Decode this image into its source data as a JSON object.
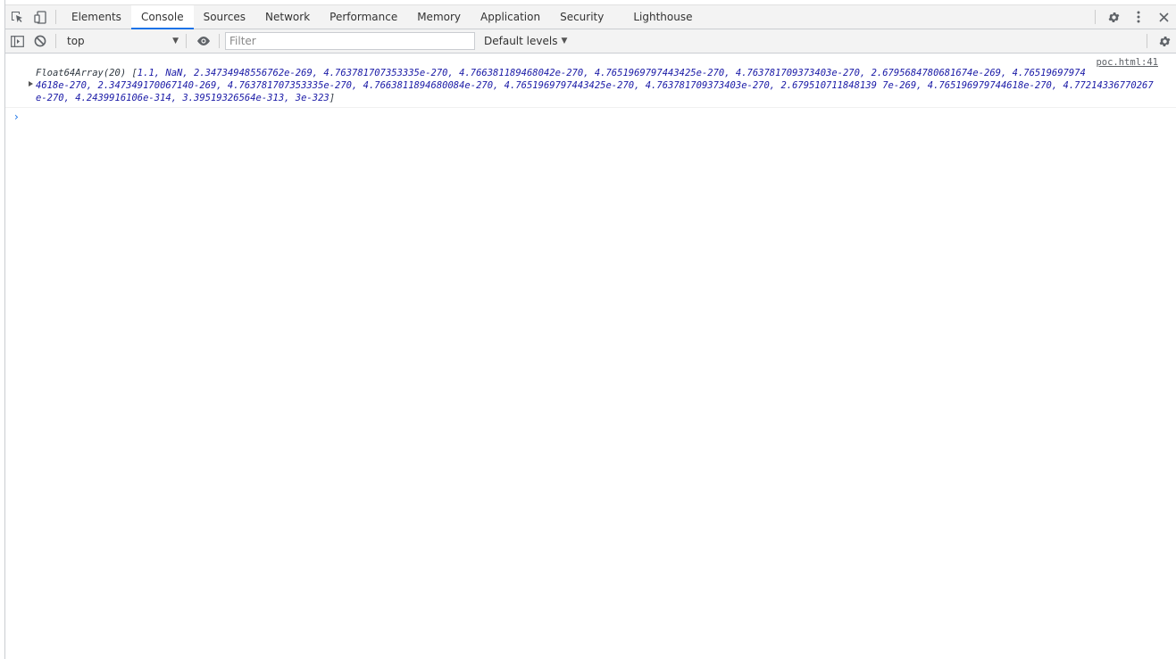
{
  "tabs": [
    {
      "label": "Elements",
      "active": false
    },
    {
      "label": "Console",
      "active": true
    },
    {
      "label": "Sources",
      "active": false
    },
    {
      "label": "Network",
      "active": false
    },
    {
      "label": "Performance",
      "active": false
    },
    {
      "label": "Memory",
      "active": false
    },
    {
      "label": "Application",
      "active": false
    },
    {
      "label": "Security",
      "active": false
    },
    {
      "label": "Lighthouse",
      "active": false
    }
  ],
  "toolbar": {
    "context": "top",
    "filter_placeholder": "Filter",
    "levels_label": "Default levels"
  },
  "console": {
    "message": {
      "source": "poc.html:41",
      "type_prefix": "Float64Array(20) [",
      "values": "1.1, NaN, 2.34734948556762e-269, 4.763781707353335e-270, 4.766381189468042e-270, 4.7651969797443425e-270, 4.763781709373403e-270, 2.6795684780681674e-269, 4.765196979744618e-270, 2.347349170067140-269, 4.763781707353335e-270, 4.7663811894680084e-270, 4.7651969797443425e-270, 4.763781709373403e-270, 2.679510711848139 7e-269, 4.765196979744618e-270, 4.77214336770267e-270, 4.2439916106e-314, 3.39519326564e-313, 3e-323",
      "suffix": "]"
    },
    "prompt": "›"
  },
  "colors": {
    "accent": "#1a73e8",
    "number": "#1a1aa6",
    "toolbar_bg": "#f3f3f3"
  }
}
